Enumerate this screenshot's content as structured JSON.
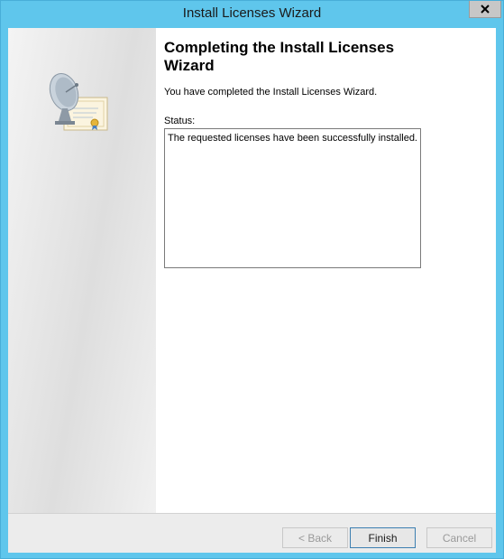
{
  "window": {
    "title": "Install Licenses Wizard",
    "close_glyph": "x"
  },
  "content": {
    "heading": "Completing the Install Licenses Wizard",
    "intro": "You have completed the Install Licenses Wizard.",
    "status_label": "Status:",
    "status_text": "The requested licenses have been successfully installed."
  },
  "buttons": {
    "back": "< Back",
    "finish": "Finish",
    "cancel": "Cancel"
  },
  "icons": {
    "side": "satellite-certificate-icon",
    "close": "close-icon"
  },
  "colors": {
    "title_bar": "#5fc6ec",
    "default_button_border": "#3c7fb1"
  }
}
